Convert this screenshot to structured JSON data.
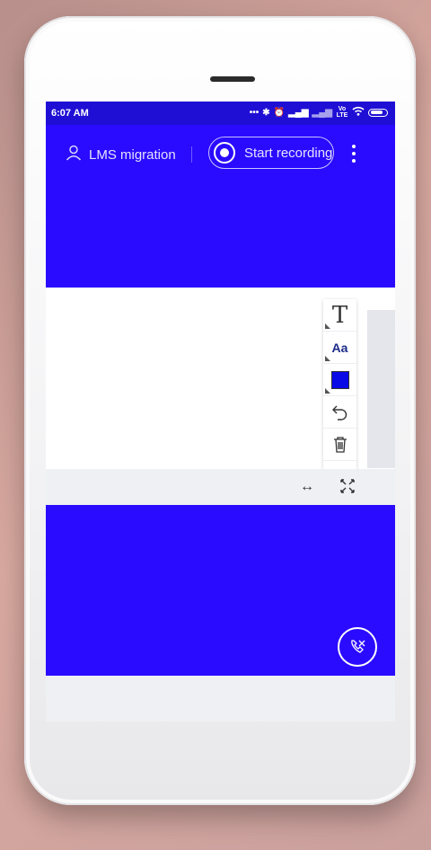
{
  "status_bar": {
    "time": "6:07 AM",
    "network": "Vo LTE"
  },
  "header": {
    "user_label": "LMS migration",
    "record_label": "Start recording"
  },
  "toolbar": {
    "text_tool": "T",
    "font_tool": "Aa",
    "selected_color": "#0a0ae6"
  },
  "view_controls": {
    "expand_icon": "↔"
  },
  "colors": {
    "brand": "#2a0bff",
    "status_bar": "#1f0fd4",
    "background": "#eef0f4"
  }
}
